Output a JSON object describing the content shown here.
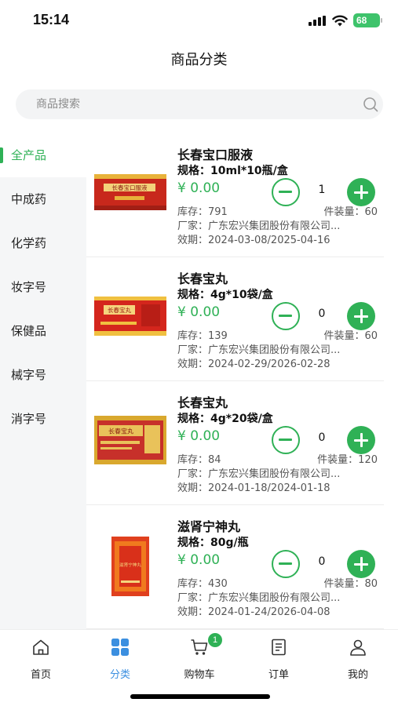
{
  "status_bar": {
    "time": "15:14",
    "battery": "68"
  },
  "header": {
    "title": "商品分类"
  },
  "search": {
    "placeholder": "商品搜索"
  },
  "categories": [
    {
      "label": "全产品",
      "active": true
    },
    {
      "label": "中成药"
    },
    {
      "label": "化学药"
    },
    {
      "label": "妆字号"
    },
    {
      "label": "保健品"
    },
    {
      "label": "械字号"
    },
    {
      "label": "消字号"
    }
  ],
  "products": [
    {
      "name": "长春宝口服液",
      "spec": "规格：10ml*10瓶/盒",
      "price": "¥ 0.00",
      "qty": "1",
      "stock": "库存：791",
      "pack": "件装量：60",
      "maker": "厂家：广东宏兴集团股份有限公司...",
      "expiry": "效期：2024-03-08/2025-04-16",
      "box_label": "长春宝口服液"
    },
    {
      "name": "长春宝丸",
      "spec": "规格：4g*10袋/盒",
      "price": "¥ 0.00",
      "qty": "0",
      "stock": "库存：139",
      "pack": "件装量：60",
      "maker": "厂家：广东宏兴集团股份有限公司...",
      "expiry": "效期：2024-02-29/2026-02-28",
      "box_label": "长春宝丸"
    },
    {
      "name": "长春宝丸",
      "spec": "规格：4g*20袋/盒",
      "price": "¥ 0.00",
      "qty": "0",
      "stock": "库存：84",
      "pack": "件装量：120",
      "maker": "厂家：广东宏兴集团股份有限公司...",
      "expiry": "效期：2024-01-18/2024-01-18",
      "box_label": "长春宝丸"
    },
    {
      "name": "滋肾宁神丸",
      "spec": "规格：80g/瓶",
      "price": "¥ 0.00",
      "qty": "0",
      "stock": "库存：430",
      "pack": "件装量：80",
      "maker": "厂家：广东宏兴集团股份有限公司...",
      "expiry": "效期：2024-01-24/2026-04-08",
      "box_label": "滋肾宁神丸"
    }
  ],
  "tabbar": {
    "items": [
      {
        "label": "首页",
        "icon": "home-icon"
      },
      {
        "label": "分类",
        "icon": "grid-icon",
        "active": true
      },
      {
        "label": "购物车",
        "icon": "cart-icon",
        "badge": "1"
      },
      {
        "label": "订单",
        "icon": "order-icon"
      },
      {
        "label": "我的",
        "icon": "user-icon"
      }
    ]
  },
  "colors": {
    "accent": "#2fb156",
    "tab_active": "#3b8fe0",
    "sidebar_bg": "#f5f6f7"
  }
}
